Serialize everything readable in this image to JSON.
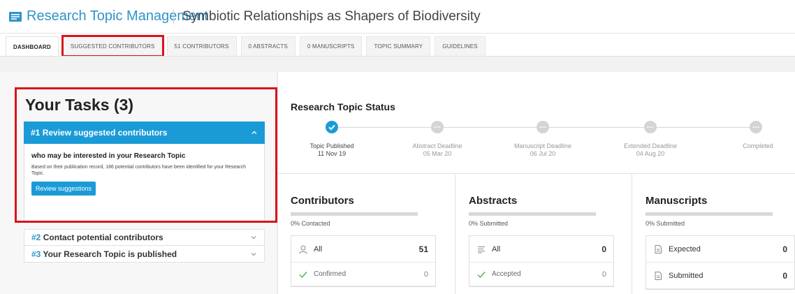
{
  "header": {
    "app_title": "Research Topic Management",
    "topic_title": "Symbiotic Relationships as Shapers of Biodiversity"
  },
  "tabs": [
    {
      "label": "DASHBOARD",
      "active": true
    },
    {
      "label": "SUGGESTED CONTRIBUTORS",
      "highlighted": true
    },
    {
      "label": "51 CONTRIBUTORS"
    },
    {
      "label": "0 ABSTRACTS"
    },
    {
      "label": "0 MANUSCRIPTS"
    },
    {
      "label": "TOPIC SUMMARY"
    },
    {
      "label": "GUIDELINES"
    }
  ],
  "tasks": {
    "title": "Your Tasks (3)",
    "items": [
      {
        "number": "#1",
        "label": "Review suggested contributors",
        "subtitle": "who may be interested in your Research Topic",
        "description": "Based on their publication record, 186 potential contributors have been identified for your Research Topic.",
        "button": "Review suggestions"
      },
      {
        "number": "#2",
        "label": "Contact potential contributors"
      },
      {
        "number": "#3",
        "label": "Your Research Topic is published"
      }
    ]
  },
  "status": {
    "title": "Research Topic Status",
    "steps": [
      {
        "label": "Topic Published",
        "date": "11 Nov 19",
        "done": true
      },
      {
        "label": "Abstract Deadline",
        "date": "05 Mar 20",
        "done": false
      },
      {
        "label": "Manuscript Deadline",
        "date": "06 Jul 20",
        "done": false
      },
      {
        "label": "Extended Deadline",
        "date": "04 Aug 20",
        "done": false
      },
      {
        "label": "Completed",
        "date": "",
        "done": false
      }
    ]
  },
  "stats": {
    "contributors": {
      "title": "Contributors",
      "progress_pct": 0,
      "sub": "0% Contacted",
      "rows": [
        {
          "label": "All",
          "value": "51",
          "icon": "user-icon"
        },
        {
          "label": "Confirmed",
          "value": "0",
          "icon": "check-icon"
        }
      ]
    },
    "abstracts": {
      "title": "Abstracts",
      "progress_pct": 0,
      "sub": "0% Submitted",
      "rows": [
        {
          "label": "All",
          "value": "0",
          "icon": "list-icon"
        },
        {
          "label": "Accepted",
          "value": "0",
          "icon": "check-icon"
        }
      ]
    },
    "manuscripts": {
      "title": "Manuscripts",
      "progress_pct": 0,
      "sub": "0% Submitted",
      "rows": [
        {
          "label": "Expected",
          "value": "0",
          "icon": "document-icon"
        },
        {
          "label": "Submitted",
          "value": "0",
          "icon": "document-icon"
        }
      ]
    }
  },
  "colors": {
    "accent": "#1a9bd7",
    "highlight": "#d9141c"
  }
}
